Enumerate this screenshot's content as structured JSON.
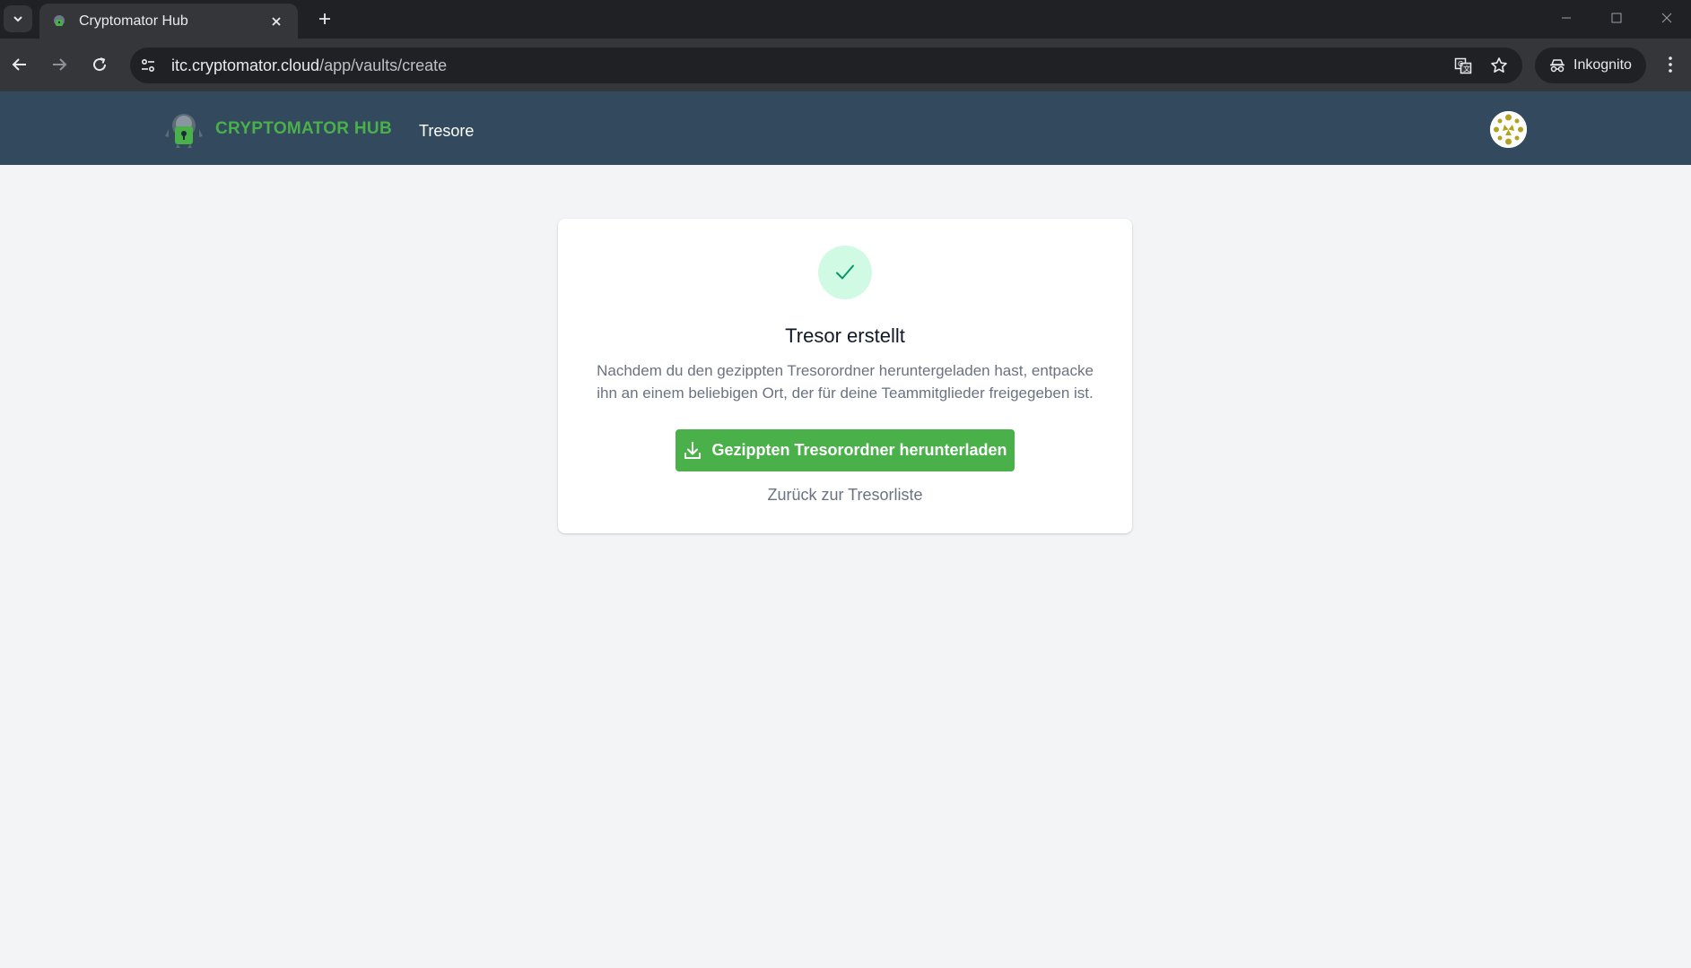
{
  "browser": {
    "tab": {
      "title": "Cryptomator Hub"
    },
    "url": {
      "host": "itc.cryptomator.cloud",
      "path": "/app/vaults/create"
    },
    "profile": {
      "label": "Inkognito"
    }
  },
  "header": {
    "brand": "CRYPTOMATOR HUB",
    "nav": [
      {
        "label": "Tresore"
      }
    ]
  },
  "card": {
    "title": "Tresor erstellt",
    "description": "Nachdem du den gezippten Tresorordner heruntergeladen hast, entpacke ihn an einem beliebigen Ort, der für deine Teammitglieder freigegeben ist.",
    "download_label": "Gezippten Tresorordner herunterladen",
    "back_label": "Zurück zur Tresorliste"
  },
  "colors": {
    "header_bg": "#334a5e",
    "brand_green": "#49b04a",
    "success_bg": "#d1fae5",
    "success_check": "#059669",
    "page_bg": "#f3f4f6"
  },
  "icons": {
    "tab_search": "chevron-down-icon",
    "tab_close": "close-icon",
    "new_tab": "plus-icon",
    "back": "arrow-left-icon",
    "forward": "arrow-right-icon",
    "reload": "reload-icon",
    "site_info": "tune-icon",
    "translate": "translate-icon",
    "bookmark": "star-icon",
    "incognito": "incognito-icon",
    "menu": "kebab-menu-icon",
    "success": "checkmark-icon",
    "download": "download-icon"
  }
}
